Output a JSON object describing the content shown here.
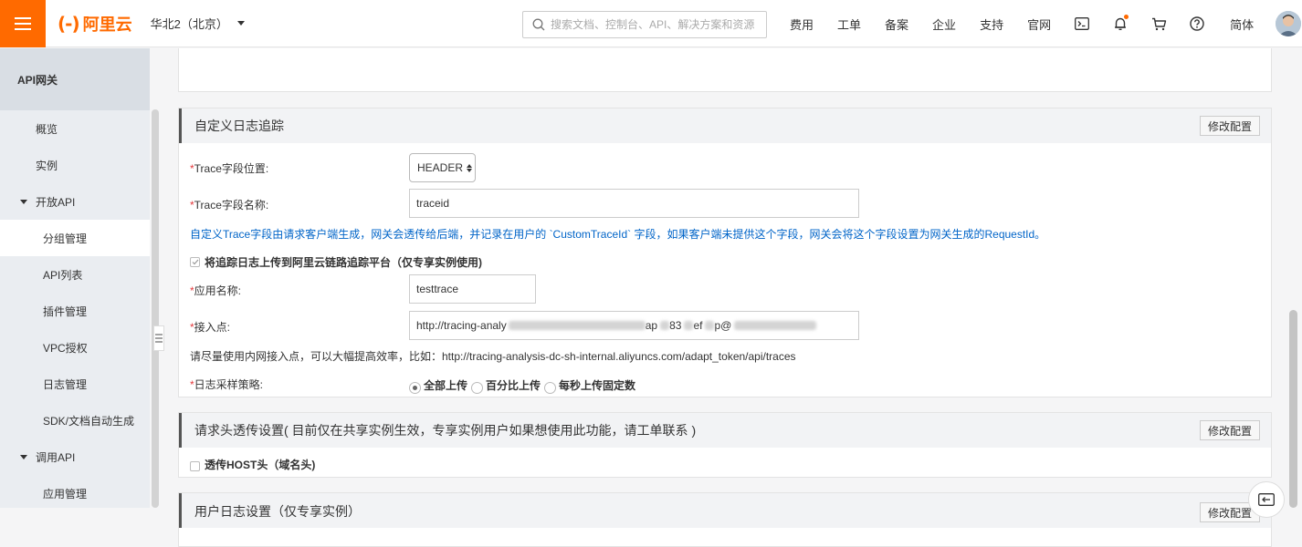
{
  "topbar": {
    "logo_text": "阿里云",
    "region": "华北2（北京）",
    "search_placeholder": "搜索文档、控制台、API、解决方案和资源",
    "nav": [
      "费用",
      "工单",
      "备案",
      "企业",
      "支持",
      "官网"
    ],
    "lang": "简体"
  },
  "sidebar": {
    "title": "API网关",
    "items": {
      "overview": "概览",
      "instances": "实例",
      "open_api": "开放API",
      "group_mgmt": "分组管理",
      "api_list": "API列表",
      "plugin_mgmt": "插件管理",
      "vpc_auth": "VPC授权",
      "log_mgmt": "日志管理",
      "sdk_doc": "SDK/文档自动生成",
      "call_api": "调用API",
      "app_mgmt": "应用管理"
    }
  },
  "trace_panel": {
    "title": "自定义日志追踪",
    "edit_button": "修改配置",
    "required_mark": "*",
    "position_label": "Trace字段位置:",
    "position_value": "HEADER",
    "name_label": "Trace字段名称:",
    "name_value": "traceid",
    "desc": "自定义Trace字段由请求客户端生成，网关会透传给后端，并记录在用户的 `CustomTraceId` 字段，如果客户端未提供这个字段，网关会将这个字段设置为网关生成的RequestId。",
    "upload_checkbox_label": "将追踪日志上传到阿里云链路追踪平台（仅专享实例使用)",
    "app_name_label": "应用名称:",
    "app_name_value": "testtrace",
    "endpoint_label": "接入点:",
    "endpoint_prefix": "http://tracing-analy",
    "endpoint_mid1": "ap",
    "endpoint_mid2": "83",
    "endpoint_mid3": "ef",
    "endpoint_mid4": "p@",
    "endpoint_hint": "请尽量使用内网接入点，可以大幅提高效率，比如：http://tracing-analysis-dc-sh-internal.aliyuncs.com/adapt_token/api/traces",
    "sampling_label": "日志采样策略:",
    "sampling_options": [
      "全部上传",
      "百分比上传",
      "每秒上传固定数"
    ],
    "sampling_selected": "全部上传"
  },
  "header_panel": {
    "title": "请求头透传设置( 目前仅在共享实例生效，专享实例用户如果想使用此功能，请工单联系 )",
    "edit_button": "修改配置",
    "host_checkbox_label": "透传HOST头（域名头)"
  },
  "user_log_panel": {
    "title": "用户日志设置（仅专享实例）",
    "edit_button": "修改配置"
  }
}
